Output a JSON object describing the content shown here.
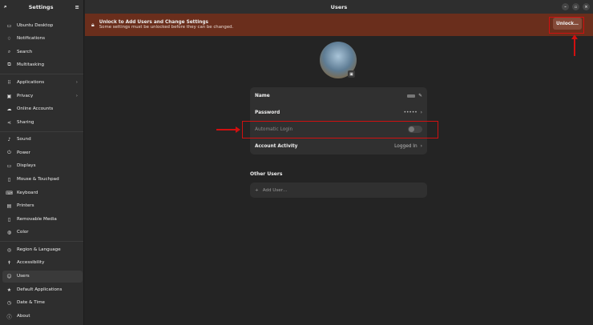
{
  "sidebar": {
    "title": "Settings",
    "items": [
      {
        "label": "Ubuntu Desktop",
        "icon": "desktop-icon"
      },
      {
        "label": "Notifications",
        "icon": "bell-icon"
      },
      {
        "label": "Search",
        "icon": "search-icon"
      },
      {
        "label": "Multitasking",
        "icon": "multitasking-icon"
      },
      {
        "label": "Applications",
        "icon": "apps-icon",
        "chevron": true
      },
      {
        "label": "Privacy",
        "icon": "lock-icon",
        "chevron": true
      },
      {
        "label": "Online Accounts",
        "icon": "cloud-icon"
      },
      {
        "label": "Sharing",
        "icon": "share-icon"
      },
      {
        "label": "Sound",
        "icon": "music-icon"
      },
      {
        "label": "Power",
        "icon": "power-icon"
      },
      {
        "label": "Displays",
        "icon": "display-icon"
      },
      {
        "label": "Mouse & Touchpad",
        "icon": "mouse-icon"
      },
      {
        "label": "Keyboard",
        "icon": "keyboard-icon"
      },
      {
        "label": "Printers",
        "icon": "printer-icon"
      },
      {
        "label": "Removable Media",
        "icon": "media-icon"
      },
      {
        "label": "Color",
        "icon": "color-icon"
      },
      {
        "label": "Region & Language",
        "icon": "globe-icon"
      },
      {
        "label": "Accessibility",
        "icon": "accessibility-icon"
      },
      {
        "label": "Users",
        "icon": "user-icon",
        "selected": true
      },
      {
        "label": "Default Applications",
        "icon": "star-icon"
      },
      {
        "label": "Date & Time",
        "icon": "clock-icon"
      },
      {
        "label": "About",
        "icon": "info-icon"
      }
    ]
  },
  "header": {
    "title": "Users"
  },
  "banner": {
    "title": "Unlock to Add Users and Change Settings",
    "subtitle": "Some settings must be unlocked before they can be changed.",
    "button": "Unlock…",
    "color": "#6a2e1c"
  },
  "account": {
    "rows": [
      {
        "label": "Name",
        "value": ""
      },
      {
        "label": "Password",
        "value": "•••••"
      },
      {
        "label": "Automatic Login",
        "toggle": false
      },
      {
        "label": "Account Activity",
        "value": "Logged In"
      }
    ]
  },
  "other_users": {
    "title": "Other Users",
    "add_label": "Add User…"
  }
}
